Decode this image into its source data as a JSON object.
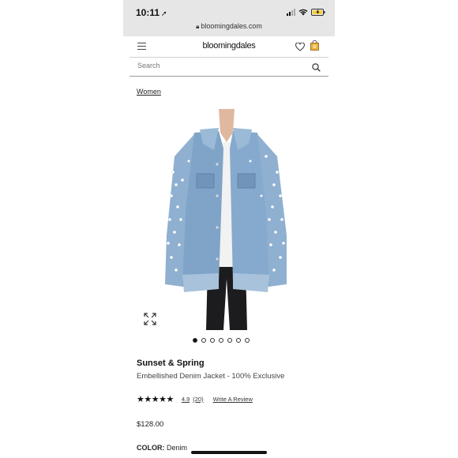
{
  "status_bar": {
    "time": "10:11",
    "location_arrow": "location-arrow-icon",
    "url": "bloomingdales.com"
  },
  "header": {
    "logo": "bloomingdales"
  },
  "search": {
    "placeholder": "Search"
  },
  "breadcrumb": "Women",
  "gallery": {
    "image_count": 7,
    "active_index": 0
  },
  "product": {
    "brand": "Sunset & Spring",
    "name": "Embellished Denim Jacket - 100% Exclusive",
    "stars": "★★★★★",
    "rating": "4.9",
    "review_count": "(20)",
    "write_review": "Write A Review",
    "price": "$128.00",
    "color_label": "COLOR:",
    "color_value": "Denim"
  },
  "colors": {
    "statusbar_bg": "#e6e6e6",
    "denim": "#7fa4c8",
    "battery": "#f4d03f"
  }
}
